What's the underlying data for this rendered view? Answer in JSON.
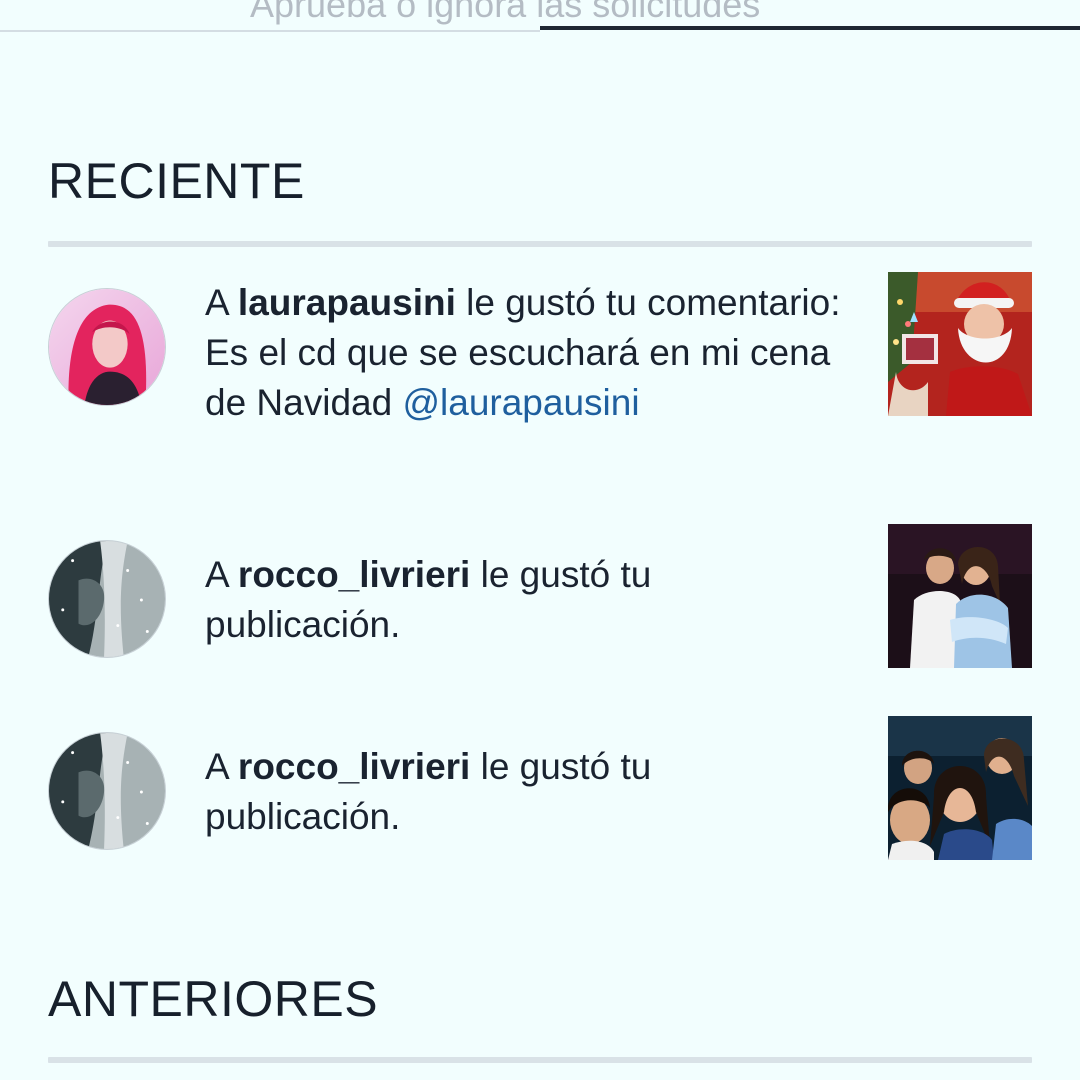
{
  "header": {
    "subtitle": "Aprueba o ignora las solicitudes"
  },
  "sections": {
    "recent_title": "RECIENTE",
    "older_title": "ANTERIORES"
  },
  "notifications": [
    {
      "prefix": "A ",
      "username": "laurapausini",
      "suffix": " le gustó tu comentario: Es el cd que se escuchará en mi cena de Navidad ",
      "mention": "@laurapausini",
      "avatar_icon": "avatar-laurapausini",
      "thumbnail_icon": "santa-photo"
    },
    {
      "prefix": "A ",
      "username": "rocco_livrieri",
      "suffix": " le gustó tu publicación.",
      "mention": "",
      "avatar_icon": "avatar-rocco-livrieri",
      "thumbnail_icon": "friends-photo"
    },
    {
      "prefix": "A ",
      "username": "rocco_livrieri",
      "suffix": " le gustó tu publicación.",
      "mention": "",
      "avatar_icon": "avatar-rocco-livrieri",
      "thumbnail_icon": "group-selfie-photo"
    }
  ],
  "colors": {
    "background": "#f2fefe",
    "text": "#17202c",
    "mention": "#1f5f9e",
    "rule": "#d9e2e7"
  }
}
